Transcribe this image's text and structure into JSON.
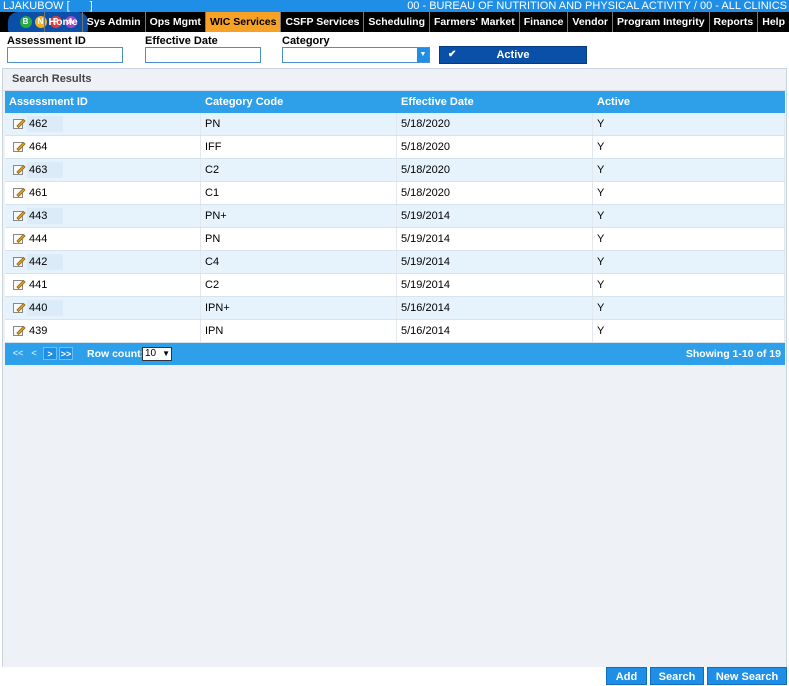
{
  "topbar": {
    "user": "LJAKUBOW [",
    "user_close": "]",
    "agency": "00 - BUREAU OF NUTRITION AND PHYSICAL ACTIVITY / 00 - ALL CLINICS"
  },
  "logo": {
    "letters": [
      "B",
      "N",
      "P",
      "A"
    ]
  },
  "nav": {
    "items": [
      "Home",
      "Sys Admin",
      "Ops Mgmt",
      "WIC Services",
      "CSFP Services",
      "Scheduling",
      "Farmers' Market",
      "Finance",
      "Vendor",
      "Program Integrity",
      "Reports",
      "Help"
    ],
    "active": "WIC Services",
    "accent_color": "#f7a226"
  },
  "filters": {
    "assessment_id_label": "Assessment ID",
    "assessment_id_value": "",
    "effective_date_label": "Effective Date",
    "effective_date_value": "",
    "category_label": "Category",
    "category_value": "",
    "active_toggle_label": "Active",
    "active_checked": true
  },
  "results": {
    "title": "Search Results",
    "columns": [
      "Assessment ID",
      "Category Code",
      "Effective Date",
      "Active"
    ],
    "rows": [
      [
        "462",
        "PN",
        "5/18/2020",
        "Y"
      ],
      [
        "464",
        "IFF",
        "5/18/2020",
        "Y"
      ],
      [
        "463",
        "C2",
        "5/18/2020",
        "Y"
      ],
      [
        "461",
        "C1",
        "5/18/2020",
        "Y"
      ],
      [
        "443",
        "PN+",
        "5/19/2014",
        "Y"
      ],
      [
        "444",
        "PN",
        "5/19/2014",
        "Y"
      ],
      [
        "442",
        "C4",
        "5/19/2014",
        "Y"
      ],
      [
        "441",
        "C2",
        "5/19/2014",
        "Y"
      ],
      [
        "440",
        "IPN+",
        "5/16/2014",
        "Y"
      ],
      [
        "439",
        "IPN",
        "5/16/2014",
        "Y"
      ]
    ]
  },
  "pager": {
    "first": "<<",
    "prev": "<",
    "next": ">",
    "last": ">>",
    "row_count_label": "Row count:",
    "row_count_value": "10",
    "showing": "Showing 1-10 of 19"
  },
  "actions": {
    "add": "Add",
    "search": "Search",
    "new_search": "New Search"
  },
  "colors": {
    "header_blue": "#1e8ee6",
    "grid_blue": "#2ea0ea",
    "button_dark": "#0a4fa8"
  }
}
